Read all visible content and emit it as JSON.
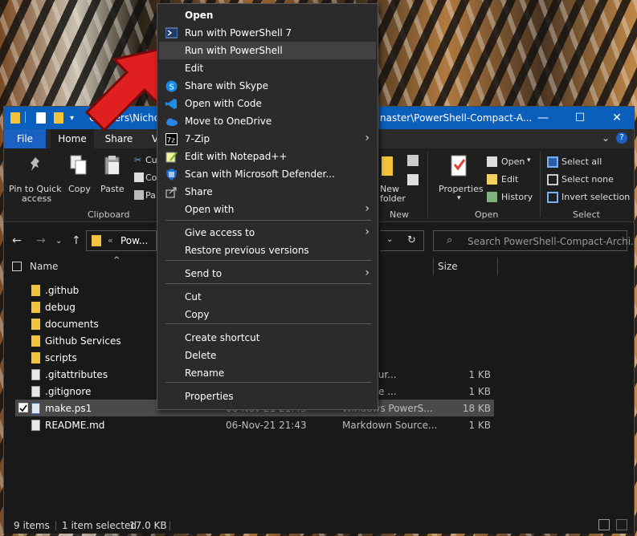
{
  "window": {
    "title_left": "C:\\Users\\Nicho",
    "title_right": "naster\\PowerShell-Compact-A...",
    "minimize": "—",
    "maximize": "☐",
    "close": "✕"
  },
  "tabs": {
    "file": "File",
    "home": "Home",
    "share": "Share",
    "view": "V"
  },
  "ribbon": {
    "pin_label_1": "Pin to Quick",
    "pin_label_2": "access",
    "copy": "Copy",
    "paste": "Paste",
    "cut_partial": "Cu",
    "copy_path_partial": "Co",
    "paste_shortcut_partial": "Pa",
    "clipboard_group": "Clipboard",
    "new_folder_1": "New",
    "new_folder_2": "folder",
    "new_group": "New",
    "properties": "Properties",
    "open": "Open",
    "edit": "Edit",
    "history": "History",
    "open_group": "Open",
    "select_all": "Select all",
    "select_none": "Select none",
    "invert_selection": "Invert selection",
    "select_group": "Select"
  },
  "address": {
    "crumb": "Pow...",
    "crumb_prefix": "«",
    "search_placeholder": "Search PowerShell-Compact-Archi..."
  },
  "columns": {
    "name": "Name",
    "size": "Size"
  },
  "files": [
    {
      "name": ".github",
      "date": "",
      "type": "r",
      "size": "",
      "kind": "folder"
    },
    {
      "name": "debug",
      "date": "",
      "type": "r",
      "size": "",
      "kind": "folder"
    },
    {
      "name": "documents",
      "date": "",
      "type": "r",
      "size": "",
      "kind": "folder"
    },
    {
      "name": "Github Services",
      "date": "",
      "type": "r",
      "size": "",
      "kind": "folder"
    },
    {
      "name": "scripts",
      "date": "",
      "type": "r",
      "size": "",
      "kind": "folder"
    },
    {
      "name": ".gitattributes",
      "date": "",
      "type": "utes Sour...",
      "size": "1 KB",
      "kind": "file"
    },
    {
      "name": ".gitignore",
      "date": "",
      "type": "e Source ...",
      "size": "1 KB",
      "kind": "file"
    },
    {
      "name": "make.ps1",
      "date": "06-Nov-21 21:43",
      "type": "Windows PowerS...",
      "size": "18 KB",
      "kind": "ps1",
      "selected": true
    },
    {
      "name": "README.md",
      "date": "06-Nov-21 21:43",
      "type": "Markdown Source...",
      "size": "1 KB",
      "kind": "file"
    }
  ],
  "status": {
    "items": "9 items",
    "selected": "1 item selected",
    "size": "17.0 KB"
  },
  "context_menu": {
    "items": [
      {
        "label": "Open",
        "bold": true,
        "icon": "none"
      },
      {
        "label": "Run with PowerShell 7",
        "icon": "powershell-icon"
      },
      {
        "label": "Run with PowerShell",
        "icon": "none",
        "hover": true
      },
      {
        "label": "Edit",
        "icon": "none"
      },
      {
        "label": "Share with Skype",
        "icon": "skype-icon"
      },
      {
        "label": "Open with Code",
        "icon": "vscode-icon"
      },
      {
        "label": "Move to OneDrive",
        "icon": "onedrive-icon"
      },
      {
        "label": "7-Zip",
        "icon": "7zip-icon",
        "submenu": true
      },
      {
        "label": "Edit with Notepad++",
        "icon": "notepadpp-icon"
      },
      {
        "label": "Scan with Microsoft Defender...",
        "icon": "defender-icon"
      },
      {
        "label": "Share",
        "icon": "share-icon"
      },
      {
        "label": "Open with",
        "icon": "none",
        "submenu": true
      },
      {
        "label": "Give access to",
        "icon": "none",
        "submenu": true
      },
      {
        "label": "Restore previous versions",
        "icon": "none"
      },
      {
        "label": "Send to",
        "icon": "none",
        "submenu": true
      },
      {
        "label": "Cut",
        "icon": "none"
      },
      {
        "label": "Copy",
        "icon": "none"
      },
      {
        "label": "Create shortcut",
        "icon": "none"
      },
      {
        "label": "Delete",
        "icon": "none"
      },
      {
        "label": "Rename",
        "icon": "none"
      },
      {
        "label": "Properties",
        "icon": "none"
      }
    ],
    "submenu_glyph": "›"
  },
  "colors": {
    "accent": "#0a5fbd",
    "arrow": "#e02020"
  }
}
